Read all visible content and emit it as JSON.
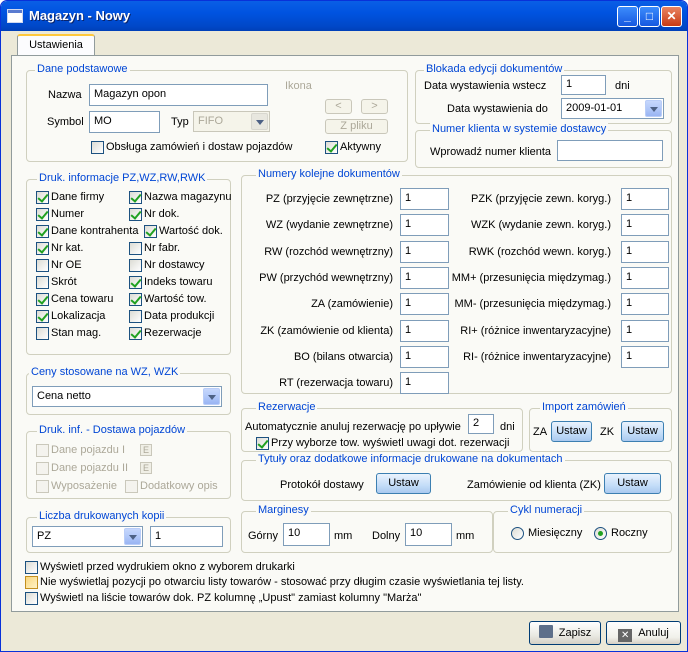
{
  "window": {
    "title": "Magazyn - Nowy",
    "min": "_",
    "max": "□",
    "close": "✕"
  },
  "tab": "Ustawienia",
  "basic": {
    "title": "Dane podstawowe",
    "name_label": "Nazwa",
    "name_value": "Magazyn opon",
    "symbol_label": "Symbol",
    "symbol_value": "MO",
    "type_label": "Typ",
    "type_value": "FIFO",
    "icon_label": "Ikona",
    "prev": "<",
    "next": ">",
    "from_file": "Z pliku",
    "orders_label": "Obsługa zamówień i dostaw pojazdów",
    "active_label": "Aktywny"
  },
  "lock": {
    "title": "Blokada edycji dokumentów",
    "back_label": "Data wystawienia wstecz",
    "back_value": "1",
    "days": "dni",
    "to_label": "Data wystawienia do",
    "to_value": "2009-01-01"
  },
  "clientnum": {
    "title": "Numer klienta w systemie dostawcy",
    "label": "Wprowadź numer klienta",
    "value": ""
  },
  "print": {
    "title": "Druk. informacje PZ,WZ,RW,RWK",
    "items": [
      {
        "label": "Dane firmy",
        "on": true
      },
      {
        "label": "Nazwa magazynu",
        "on": true
      },
      {
        "label": "Numer",
        "on": true
      },
      {
        "label": "Nr dok.",
        "on": true
      },
      {
        "label": "Dane kontrahenta",
        "on": true
      },
      {
        "label": "Wartość dok.",
        "on": true
      },
      {
        "label": "Nr kat.",
        "on": true
      },
      {
        "label": "Nr fabr.",
        "on": false
      },
      {
        "label": "Nr OE",
        "on": false
      },
      {
        "label": "Nr dostawcy",
        "on": false
      },
      {
        "label": "Skrót",
        "on": false
      },
      {
        "label": "Indeks towaru",
        "on": true
      },
      {
        "label": "Cena towaru",
        "on": true
      },
      {
        "label": "Wartość tow.",
        "on": true
      },
      {
        "label": "Lokalizacja",
        "on": true
      },
      {
        "label": "Data produkcji",
        "on": false
      },
      {
        "label": "Stan mag.",
        "on": false
      },
      {
        "label": "Rezerwacje",
        "on": true
      }
    ]
  },
  "prices": {
    "title": "Ceny stosowane na WZ, WZK",
    "value": "Cena netto"
  },
  "vehicle": {
    "title": "Druk. inf. - Dostawa pojazdów",
    "d1": "Dane pojazdu I",
    "d2": "Dane pojazdu II",
    "equip": "Wyposażenie",
    "extra": "Dodatkowy opis",
    "e": "E"
  },
  "copies": {
    "title": "Liczba drukowanych kopii",
    "type": "PZ",
    "count": "1"
  },
  "numbers": {
    "title": "Numery kolejne dokumentów",
    "left": [
      {
        "label": "PZ (przyjęcie zewnętrzne)",
        "value": "1"
      },
      {
        "label": "WZ (wydanie zewnętrzne)",
        "value": "1"
      },
      {
        "label": "RW (rozchód wewnętrzny)",
        "value": "1"
      },
      {
        "label": "PW (przychód wewnętrzny)",
        "value": "1"
      },
      {
        "label": "ZA (zamówienie)",
        "value": "1"
      },
      {
        "label": "ZK (zamówienie od klienta)",
        "value": "1"
      },
      {
        "label": "BO (bilans otwarcia)",
        "value": "1"
      },
      {
        "label": "RT (rezerwacja towaru)",
        "value": "1"
      }
    ],
    "right": [
      {
        "label": "PZK (przyjęcie zewn. koryg.)",
        "value": "1"
      },
      {
        "label": "WZK (wydanie zewn. koryg.)",
        "value": "1"
      },
      {
        "label": "RWK (rozchód wewn. koryg.)",
        "value": "1"
      },
      {
        "label": "MM+ (przesunięcia międzymag.)",
        "value": "1"
      },
      {
        "label": "MM- (przesunięcia międzymag.)",
        "value": "1"
      },
      {
        "label": "RI+ (różnice inwentaryzacyjne)",
        "value": "1"
      },
      {
        "label": "RI- (różnice inwentaryzacyjne)",
        "value": "1"
      }
    ]
  },
  "reservations": {
    "title": "Rezerwacje",
    "auto_label": "Automatycznie anuluj rezerwację po upływie",
    "auto_value": "2",
    "days": "dni",
    "warn_label": "Przy wyborze tow. wyświetl uwagi dot. rezerwacji"
  },
  "import": {
    "title": "Import zamówień",
    "za": "ZA",
    "zk": "ZK",
    "btn": "Ustaw"
  },
  "titles": {
    "title": "Tytuły oraz dodatkowe informacje drukowane na dokumentach",
    "protocol": "Protokół dostawy",
    "zk": "Zamówienie od klienta (ZK)",
    "btn": "Ustaw"
  },
  "margins": {
    "title": "Marginesy",
    "top_label": "Górny",
    "top_value": "10",
    "bottom_label": "Dolny",
    "bottom_value": "10",
    "unit": "mm"
  },
  "cycle": {
    "title": "Cykl numeracji",
    "monthly": "Miesięczny",
    "yearly": "Roczny"
  },
  "options": {
    "o1": "Wyświetl przed wydrukiem okno z wyborem drukarki",
    "o2": "Nie wyświetlaj pozycji po otwarciu listy towarów -  stosować przy długim czasie wyświetlania tej listy.",
    "o3": "Wyświetl na liście towarów dok. PZ kolumnę „Upust\" zamiast kolumny \"Marża\""
  },
  "footer": {
    "save": "Zapisz",
    "cancel": "Anuluj"
  }
}
